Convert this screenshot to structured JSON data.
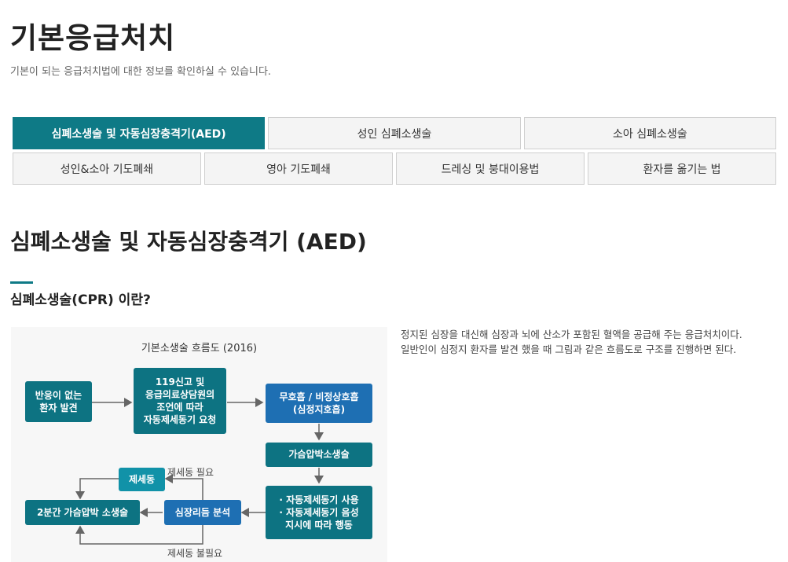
{
  "header": {
    "title": "기본응급처치",
    "subtitle": "기본이 되는 응급처치법에 대한 정보를 확인하실 수 있습니다."
  },
  "tabs": {
    "row1": [
      {
        "label": "심폐소생술 및 자동심장충격기(AED)",
        "active": true
      },
      {
        "label": "성인 심폐소생술",
        "active": false
      },
      {
        "label": "소아 심폐소생술",
        "active": false
      }
    ],
    "row2": [
      {
        "label": "성인&소아 기도폐쇄",
        "active": false
      },
      {
        "label": "영아 기도폐쇄",
        "active": false
      },
      {
        "label": "드레싱 및 붕대이용법",
        "active": false
      },
      {
        "label": "환자를 옮기는 법",
        "active": false
      }
    ]
  },
  "section": {
    "title": "심폐소생술 및 자동심장충격기 (AED)",
    "subtitle": "심폐소생술(CPR) 이란?"
  },
  "flowchart": {
    "title": "기본소생술 흐름도 (2016)",
    "box_unresponsive": "반응이 없는\n환자 발견",
    "box_call": "119신고 및\n응급의료상담원의\n조언에 따라\n자동제세동기 요청",
    "box_breathing": "무호흡 / 비정상호흡\n(심정지호흡)",
    "box_compression": "가슴압박소생술",
    "box_aed": "· 자동제세동기 사용\n· 자동제세동기 음성\n지시에 따라 행동",
    "box_rhythm": "심장리듬 분석",
    "box_defib": "제세동",
    "box_2min": "2분간 가슴압박 소생술",
    "label_needed": "제세동 필요",
    "label_not_needed": "제세동 불필요"
  },
  "description": {
    "line1": "정지된 심장을 대신해 심장과 뇌에 산소가 포함된 혈액을 공급해 주는 응급처치이다.",
    "line2": "일반인이 심정지 환자를 발견 했을 때 그림과 같은 흐름도로 구조를 진행하면 된다."
  },
  "colors": {
    "accent": "#0e7a86",
    "box_teal": "#0d7382",
    "box_blue": "#1e6fb3",
    "box_cyan": "#1192a8"
  }
}
